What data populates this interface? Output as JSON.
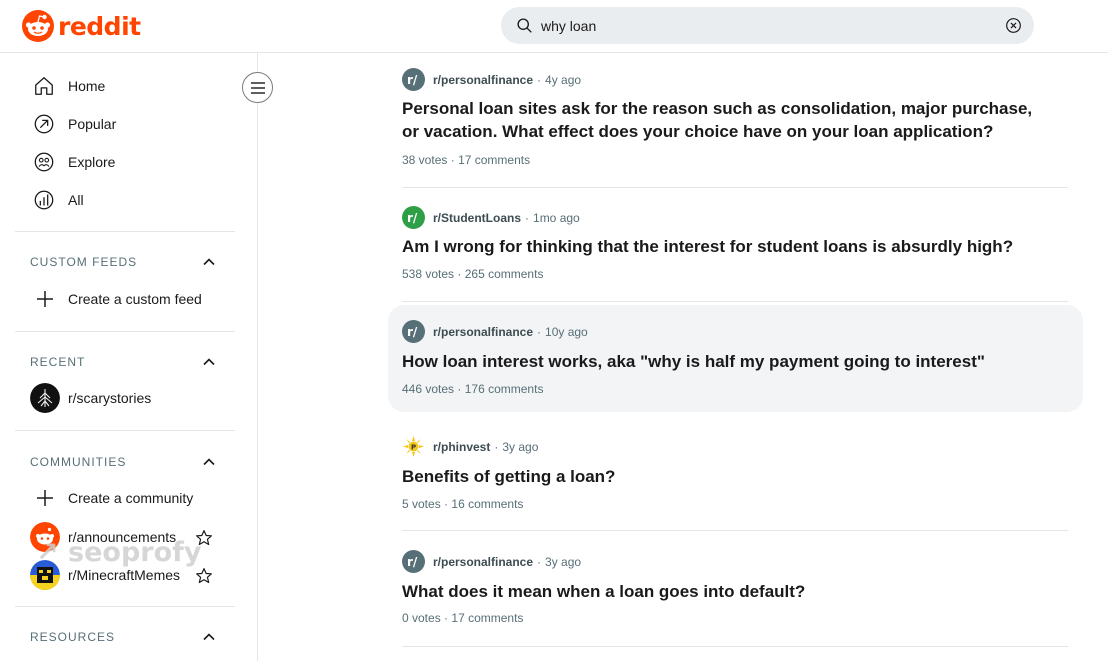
{
  "brand": {
    "name": "reddit",
    "color": "#ff4500"
  },
  "search": {
    "value": "why loan"
  },
  "nav": [
    {
      "label": "Home",
      "icon": "home-icon"
    },
    {
      "label": "Popular",
      "icon": "popular-icon"
    },
    {
      "label": "Explore",
      "icon": "explore-icon"
    },
    {
      "label": "All",
      "icon": "all-icon"
    }
  ],
  "custom_feeds": {
    "title": "CUSTOM FEEDS",
    "create_label": "Create a custom feed"
  },
  "recent": {
    "title": "RECENT",
    "items": [
      {
        "label": "r/scarystories"
      }
    ]
  },
  "communities": {
    "title": "COMMUNITIES",
    "create_label": "Create a community",
    "items": [
      {
        "label": "r/announcements"
      },
      {
        "label": "r/MinecraftMemes"
      }
    ]
  },
  "resources": {
    "title": "RESOURCES"
  },
  "watermark": "seoprofy",
  "posts": [
    {
      "subreddit": "r/personalfinance",
      "age": "4y ago",
      "title": "Personal loan sites ask for the reason such as consolidation, major purchase, or vacation. What effect does your choice have on your loan application?",
      "votes": "38 votes",
      "comments": "17 comments"
    },
    {
      "subreddit": "r/StudentLoans",
      "age": "1mo ago",
      "title": "Am I wrong for thinking that the interest for student loans is absurdly high?",
      "votes": "538 votes",
      "comments": "265 comments"
    },
    {
      "subreddit": "r/personalfinance",
      "age": "10y ago",
      "title": "How loan interest works, aka \"why is half my payment going to interest\"",
      "votes": "446 votes",
      "comments": "176 comments"
    },
    {
      "subreddit": "r/phinvest",
      "age": "3y ago",
      "title": "Benefits of getting a loan?",
      "votes": "5 votes",
      "comments": "16 comments"
    },
    {
      "subreddit": "r/personalfinance",
      "age": "3y ago",
      "title": "What does it mean when a loan goes into default?",
      "votes": "0 votes",
      "comments": "17 comments"
    }
  ]
}
